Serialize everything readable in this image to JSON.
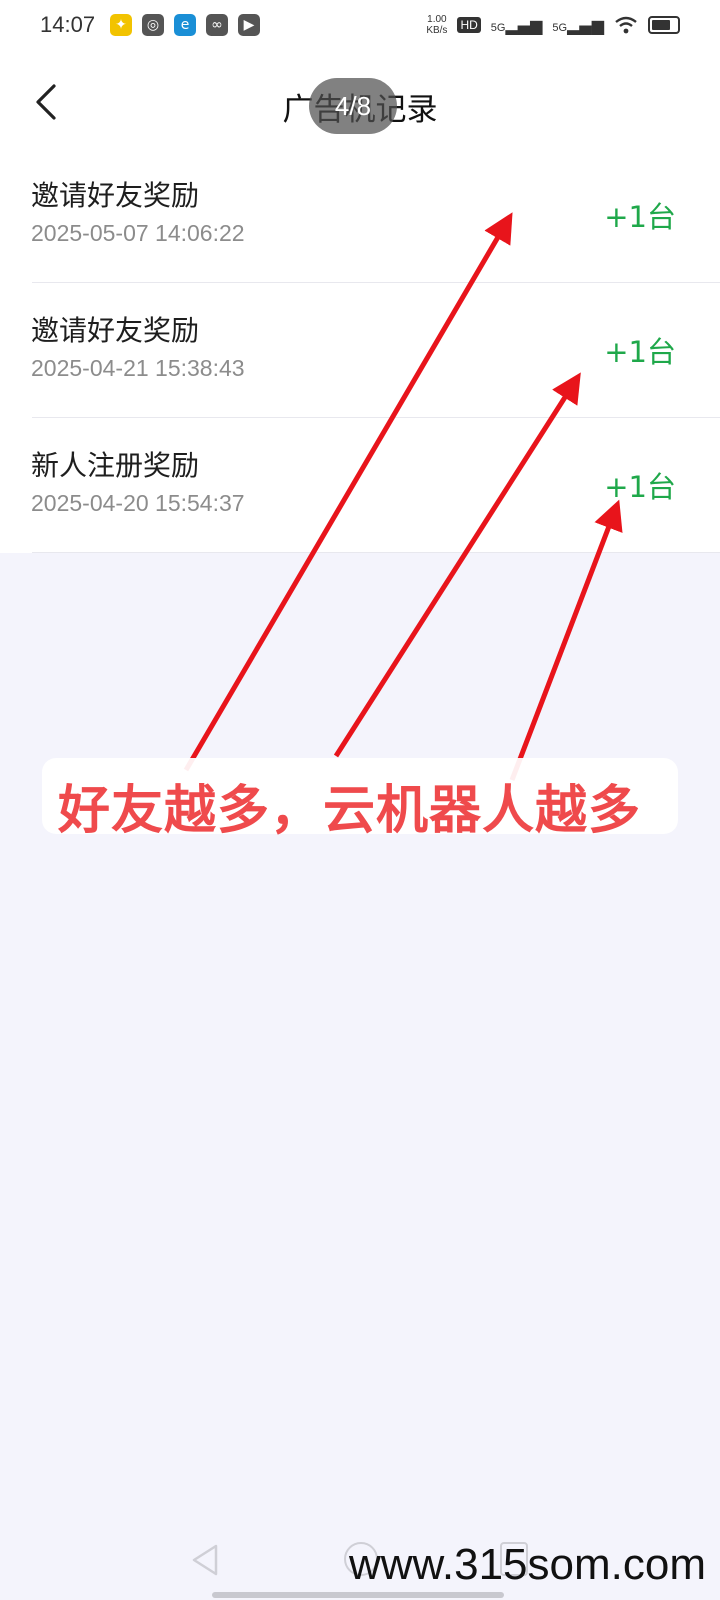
{
  "status_bar": {
    "time": "14:07",
    "network_speed_value": "1.00",
    "network_speed_unit": "KB/s",
    "hd_badge": "HD",
    "signal_1": "5G",
    "signal_2": "5G"
  },
  "header": {
    "title": "广告机记录",
    "page_indicator": "4/8"
  },
  "records": [
    {
      "title": "邀请好友奖励",
      "time": "2025-05-07 14:06:22",
      "amount": "+1台"
    },
    {
      "title": "邀请好友奖励",
      "time": "2025-04-21 15:38:43",
      "amount": "+1台"
    },
    {
      "title": "新人注册奖励",
      "time": "2025-04-20 15:54:37",
      "amount": "+1台"
    }
  ],
  "annotation": {
    "caption": "好友越多，云机器人越多",
    "arrow_color": "#e8141b"
  },
  "watermark": "www.315som.com",
  "colors": {
    "amount_green": "#1fa84a",
    "page_background": "#f4f4fc",
    "caption_red": "#ef4a4c"
  }
}
